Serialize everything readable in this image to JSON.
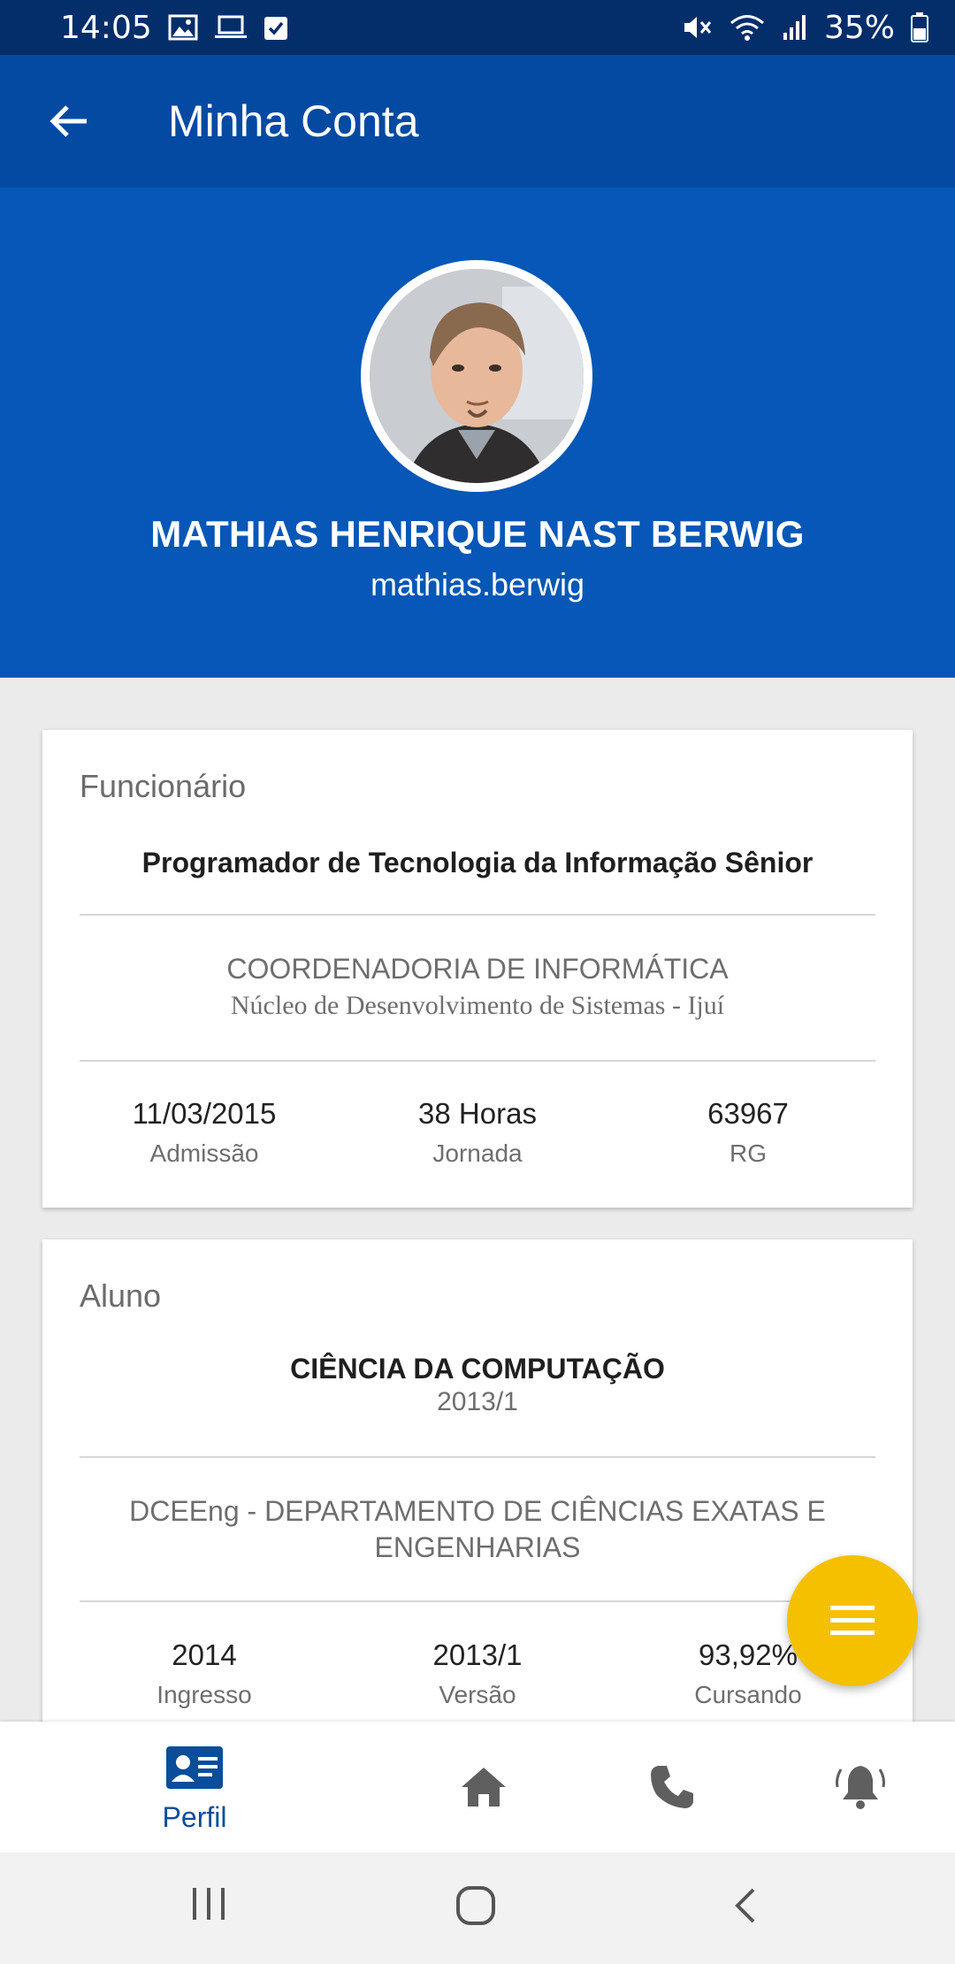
{
  "status_bar": {
    "time": "14:05",
    "battery": "35%",
    "left_icons": [
      "image-icon",
      "laptop-icon",
      "checkbox-icon"
    ],
    "right_icons": [
      "mute-icon",
      "wifi-icon",
      "signal-icon",
      "battery-icon"
    ]
  },
  "app_bar": {
    "title": "Minha Conta",
    "back_icon": "arrow-left-icon"
  },
  "profile": {
    "name": "MATHIAS HENRIQUE NAST BERWIG",
    "login": "mathias.berwig",
    "avatar_icon": "user-photo"
  },
  "employee_card": {
    "label": "Funcionário",
    "role": "Programador de Tecnologia da Informação Sênior",
    "department": "COORDENADORIA DE INFORMÁTICA",
    "unit": "Núcleo de Desenvolvimento de Sistemas - Ijuí",
    "stats": [
      {
        "value": "11/03/2015",
        "label": "Admissão"
      },
      {
        "value": "38 Horas",
        "label": "Jornada"
      },
      {
        "value": "63967",
        "label": "RG"
      }
    ]
  },
  "student_card": {
    "label": "Aluno",
    "course": "CIÊNCIA DA COMPUTAÇÃO",
    "period": "2013/1",
    "department_line1": "DCEEng - DEPARTAMENTO DE CIÊNCIAS EXATAS E",
    "department_line2": "ENGENHARIAS",
    "stats": [
      {
        "value": "2014",
        "label": "Ingresso"
      },
      {
        "value": "2013/1",
        "label": "Versão"
      },
      {
        "value": "93,92%",
        "label": "Cursando"
      }
    ]
  },
  "fab": {
    "icon": "menu-icon"
  },
  "bottom_nav": {
    "items": [
      {
        "label": "Perfil",
        "icon": "id-card-icon",
        "active": true
      },
      {
        "label": "",
        "icon": "home-icon",
        "active": false
      },
      {
        "label": "",
        "icon": "phone-icon",
        "active": false
      },
      {
        "label": "",
        "icon": "bell-icon",
        "active": false
      }
    ]
  },
  "system_nav": {
    "buttons": [
      "recents-icon",
      "home-circle-icon",
      "system-back-icon"
    ]
  },
  "colors": {
    "status_bar": "#042e6a",
    "app_bar": "#044aa2",
    "header": "#0657b7",
    "fab": "#f5c000",
    "active_nav": "#0a4d9c",
    "inactive_nav": "#5f5f5f"
  }
}
